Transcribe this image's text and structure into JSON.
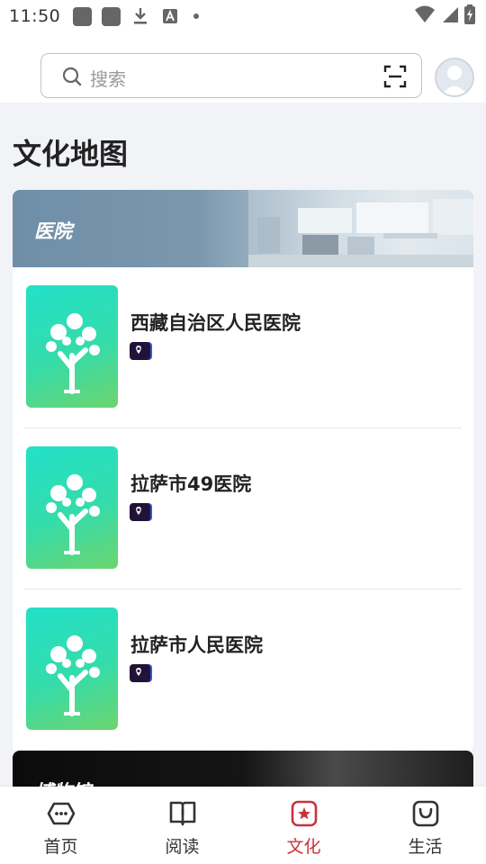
{
  "status_bar": {
    "time": "11:50",
    "icons": [
      "app-square-icon",
      "app-square-icon",
      "download-icon",
      "text-a-icon",
      "dot-icon",
      "wifi-icon",
      "signal-icon",
      "battery-charging-icon"
    ]
  },
  "search": {
    "placeholder": "搜索",
    "icon": "search-icon",
    "scan_icon": "scan-icon"
  },
  "page": {
    "title": "文化地图"
  },
  "categories": [
    {
      "label": "医院",
      "items": [
        {
          "name": "西藏自治区人民医院",
          "icon": "location-pin-icon"
        },
        {
          "name": "拉萨市49医院",
          "icon": "location-pin-icon"
        },
        {
          "name": "拉萨市人民医院",
          "icon": "location-pin-icon"
        }
      ]
    },
    {
      "label": "博物馆"
    }
  ],
  "bottom_nav": {
    "items": [
      {
        "label": "首页",
        "icon": "home-icon",
        "active": false
      },
      {
        "label": "阅读",
        "icon": "book-icon",
        "active": false
      },
      {
        "label": "文化",
        "icon": "culture-star-icon",
        "active": true
      },
      {
        "label": "生活",
        "icon": "shopping-bag-icon",
        "active": false
      }
    ],
    "active_color": "#c8333b"
  },
  "colors": {
    "accent": "#c8333b",
    "thumb_gradient_start": "#22e0c8",
    "thumb_gradient_end": "#6dd46e"
  }
}
